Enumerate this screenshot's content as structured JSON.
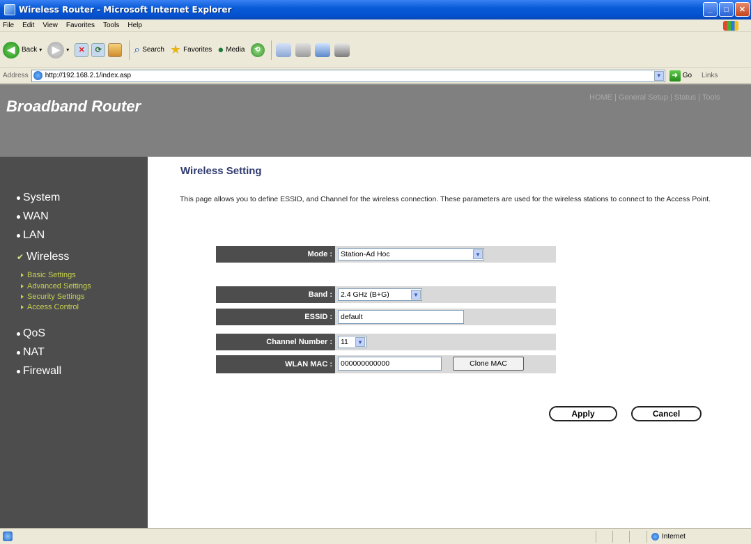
{
  "window": {
    "title": "Wireless Router - Microsoft Internet Explorer",
    "controls": [
      "minimize",
      "maximize",
      "close"
    ]
  },
  "menubar": [
    "File",
    "Edit",
    "View",
    "Favorites",
    "Tools",
    "Help"
  ],
  "toolbar": {
    "back": "Back",
    "search": "Search",
    "favorites": "Favorites",
    "media": "Media"
  },
  "addressbar": {
    "label": "Address",
    "url": "http://192.168.2.1/index.asp",
    "go": "Go",
    "links": "Links"
  },
  "header": {
    "brand": "Broadband Router",
    "topnav": [
      "HOME",
      "General Setup",
      "Status",
      "Tools"
    ]
  },
  "sidebar": {
    "items": [
      {
        "label": "System",
        "marker": "bullet"
      },
      {
        "label": "WAN",
        "marker": "bullet"
      },
      {
        "label": "LAN",
        "marker": "bullet"
      },
      {
        "label": "Wireless",
        "marker": "check"
      },
      {
        "label": "QoS",
        "marker": "bullet"
      },
      {
        "label": "NAT",
        "marker": "bullet"
      },
      {
        "label": "Firewall",
        "marker": "bullet"
      }
    ],
    "subitems": [
      "Basic Settings",
      "Advanced Settings",
      "Security Settings",
      "Access Control"
    ]
  },
  "main": {
    "title": "Wireless Setting",
    "description": "This page allows you to define ESSID, and Channel for the wireless connection. These parameters are used for the wireless stations to connect to the Access Point.",
    "fields": {
      "mode": {
        "label": "Mode :",
        "value": "Station-Ad Hoc"
      },
      "band": {
        "label": "Band :",
        "value": "2.4 GHz (B+G)"
      },
      "essid": {
        "label": "ESSID :",
        "value": "default"
      },
      "channel": {
        "label": "Channel Number :",
        "value": "11"
      },
      "wlanmac": {
        "label": "WLAN MAC :",
        "value": "000000000000",
        "button": "Clone MAC"
      }
    },
    "apply": "Apply",
    "cancel": "Cancel"
  },
  "statusbar": {
    "zone": "Internet"
  }
}
